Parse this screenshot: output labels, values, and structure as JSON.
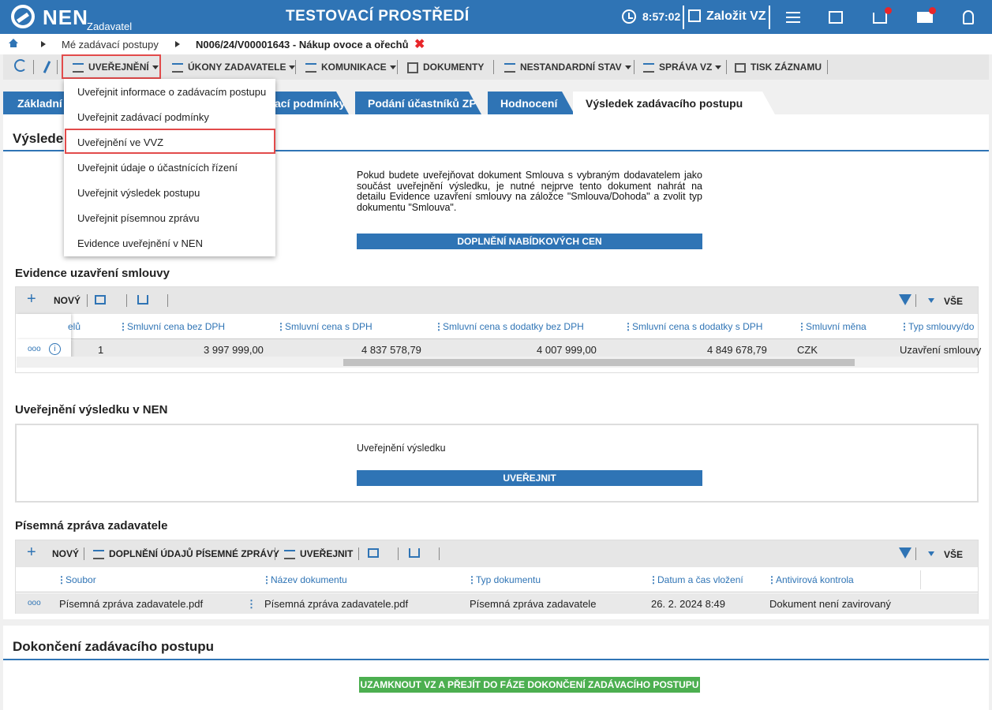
{
  "header": {
    "logo": "NEN",
    "logo_sub": "Zadavatel",
    "environment": "TESTOVACÍ PROSTŘEDÍ",
    "time": "8:57:02",
    "create_label": "Založit VZ",
    "accent": "#2f74b5"
  },
  "breadcrumb": {
    "item1": "Mé zadávací postupy",
    "item2": "N006/24/V00001643 - Nákup ovoce a ořechů",
    "close": "✖"
  },
  "toolbar": {
    "uverejneni": "UVEŘEJNĚNÍ",
    "ukony": "ÚKONY ZADAVATELE",
    "komunikace": "KOMUNIKACE",
    "dokumenty": "DOKUMENTY",
    "nestandard": "NESTANDARDNÍ STAV",
    "sprava": "SPRÁVA VZ",
    "tisk": "TISK ZÁZNAMU"
  },
  "dropdown": {
    "items": [
      "Uveřejnit informace o zadávacím postupu",
      "Uveřejnit zadávací podmínky",
      "Uveřejnění ve VVZ",
      "Uveřejnit údaje o účastnících řízení",
      "Uveřejnit výsledek postupu",
      "Uveřejnit písemnou zprávu",
      "Evidence uveřejnění v NEN"
    ]
  },
  "tabs": {
    "t1": "Základní",
    "t2": "ací podmínky",
    "t3": "Podání účastníků ZP",
    "t4": "Hodnocení",
    "t5": "Výsledek zadávacího postupu"
  },
  "section1": {
    "title": "Výsledek",
    "info": "Pokud budete uveřejňovat dokument Smlouva s vybraným dodavatelem jako součást uveřejnění výsledku, je nutné nejprve tento dokument nahrát na detailu Evidence uzavření smlouvy na záložce \"Smlouva/Dohoda\" a zvolit typ dokumentu \"Smlouva\".",
    "button": "DOPLNĚNÍ NABÍDKOVÝCH CEN"
  },
  "contracts": {
    "title": "Evidence uzavření smlouvy",
    "new": "NOVÝ",
    "all": "VŠE",
    "columns": [
      "elů",
      "Smluvní cena bez DPH",
      "Smluvní cena s DPH",
      "Smluvní cena s dodatky bez DPH",
      "Smluvní cena s dodatky s DPH",
      "Smluvní měna",
      "Typ smlouvy/do"
    ],
    "row": [
      "1",
      "3 997 999,00",
      "4 837 578,79",
      "4 007 999,00",
      "4 849 678,79",
      "CZK",
      "Uzavření smlouvy"
    ],
    "more": "ooo",
    "info_icon": "i"
  },
  "publish": {
    "title": "Uveřejnění výsledku v NEN",
    "label": "Uveřejnění výsledku",
    "button": "UVEŘEJNIT"
  },
  "report": {
    "title": "Písemná zpráva zadavatele",
    "new": "NOVÝ",
    "fill": "DOPLNĚNÍ ÚDAJŮ PÍSEMNÉ ZPRÁVY",
    "publish": "UVEŘEJNIT",
    "all": "VŠE",
    "columns": [
      "Soubor",
      "Název dokumentu",
      "Typ dokumentu",
      "Datum a čas vložení",
      "Antivirová kontrola"
    ],
    "row": [
      "Písemná zpráva zadavatele.pdf",
      "Písemná zpráva zadavatele.pdf",
      "Písemná zpráva zadavatele",
      "26. 2. 2024 8:49",
      "Dokument není zavirovaný"
    ],
    "more": "ooo"
  },
  "finish": {
    "title": "Dokončení zadávacího postupu",
    "button": "UZAMKNOUT VZ A PŘEJÍT DO FÁZE DOKONČENÍ ZADÁVACÍHO POSTUPU",
    "color": "#4caf50"
  }
}
